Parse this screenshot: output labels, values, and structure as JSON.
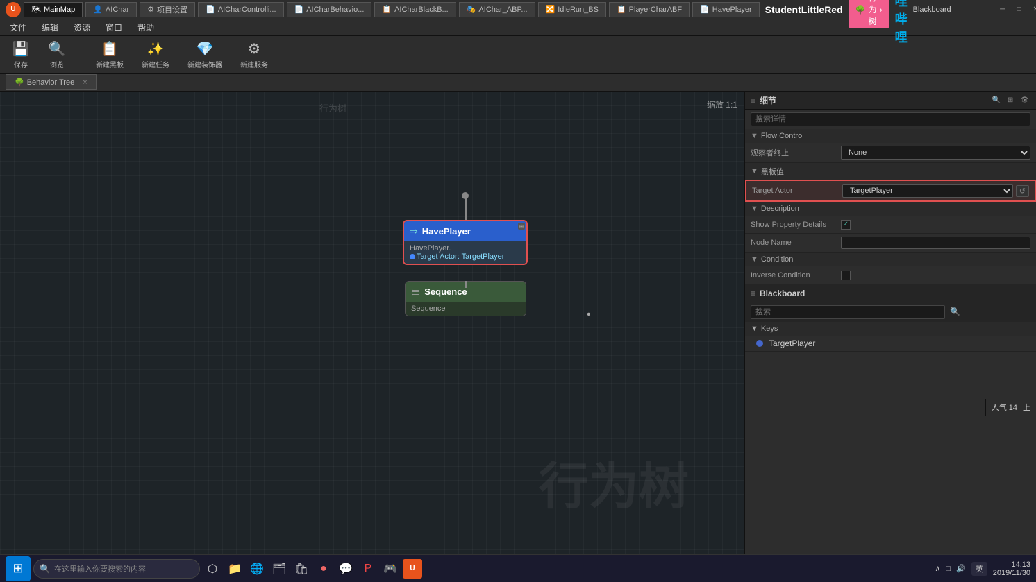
{
  "titlebar": {
    "logo": "U",
    "tabs": [
      {
        "label": "MainMap",
        "icon": "🗺",
        "active": false
      },
      {
        "label": "AIChar",
        "icon": "👤",
        "active": false
      },
      {
        "label": "项目设置",
        "icon": "⚙",
        "active": false
      },
      {
        "label": "AICharControlli...",
        "icon": "📄",
        "active": false
      },
      {
        "label": "AICharBehavio...",
        "icon": "📄",
        "active": false
      },
      {
        "label": "AICharBlackB...",
        "icon": "📋",
        "active": false
      },
      {
        "label": "AIChar_ABP...",
        "icon": "🎭",
        "active": false
      },
      {
        "label": "IdleRun_BS",
        "icon": "🔀",
        "active": false
      },
      {
        "label": "PlayerCharABF",
        "icon": "📋",
        "active": false
      },
      {
        "label": "HavePlayer",
        "icon": "📄",
        "active": true
      }
    ],
    "window_controls": [
      "─",
      "□",
      "✕"
    ]
  },
  "menubar": {
    "items": [
      "文件",
      "编辑",
      "资源",
      "窗口",
      "帮助"
    ]
  },
  "toolbar": {
    "buttons": [
      {
        "label": "保存",
        "icon": "💾"
      },
      {
        "label": "浏览",
        "icon": "🔍"
      },
      {
        "label": "新建黑板",
        "icon": "📋"
      },
      {
        "label": "新建任务",
        "icon": "✨"
      },
      {
        "label": "新建装饰器",
        "icon": "💎"
      },
      {
        "label": "新建服务",
        "icon": "⚙"
      }
    ]
  },
  "bt_tab": {
    "label": "Behavior Tree",
    "close": "×"
  },
  "canvas": {
    "title": "行为树",
    "watermark": "行为树",
    "zoom": "缩放 1:1"
  },
  "have_player_node": {
    "title": "HavePlayer",
    "subtitle": "HavePlayer.",
    "property_label": "Target Actor: TargetPlayer"
  },
  "sequence_node": {
    "title": "Sequence",
    "subtitle": "Sequence"
  },
  "right_panel": {
    "details_header": "细节",
    "search_placeholder": "搜索详情",
    "sections": {
      "flow_control": {
        "label": "Flow Control",
        "observer_abort": {
          "label": "观察者终止",
          "value": "None"
        }
      },
      "blackboard": {
        "label": "黑板值",
        "target_actor": {
          "label": "Target Actor",
          "value": "TargetPlayer"
        }
      },
      "description": {
        "label": "Description",
        "show_property_details": {
          "label": "Show Property Details",
          "checked": true
        },
        "node_name": {
          "label": "Node Name",
          "value": ""
        }
      },
      "condition": {
        "label": "Condition",
        "inverse_condition": {
          "label": "Inverse Condition",
          "checked": false
        }
      }
    }
  },
  "blackboard_panel": {
    "header": "Blackboard",
    "search_placeholder": "搜索",
    "keys_section": "Keys",
    "keys": [
      {
        "name": "TargetPlayer",
        "color": "#4466cc"
      }
    ]
  },
  "header_brand": {
    "name": "StudentLittleRed",
    "action_btn": "行为树",
    "platform": "Blackboard"
  },
  "taskbar": {
    "search_placeholder": "在这里输入你要搜索的内容",
    "time": "14:13",
    "date": "2019/11/30",
    "lang": "英",
    "popularity": "人气 14",
    "upload": "上"
  }
}
